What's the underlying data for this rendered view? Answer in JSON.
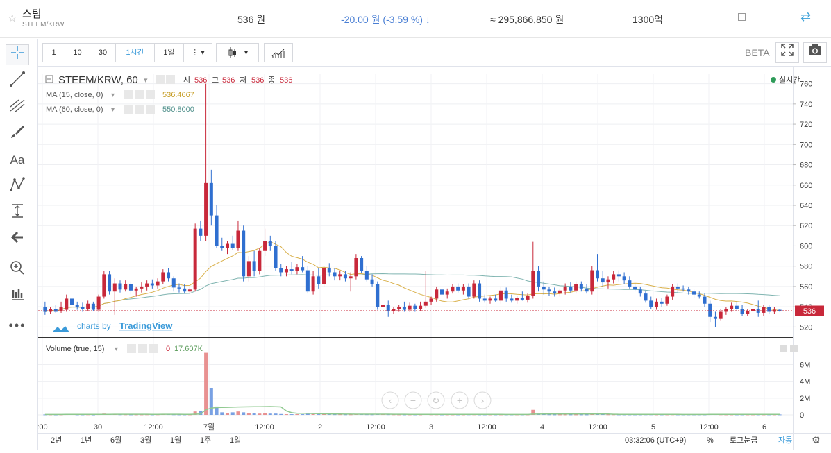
{
  "header": {
    "coin_name": "스팀",
    "pair": "STEEM/KRW",
    "price": "536 원",
    "change": "-20.00 원 (-3.59 %) ↓",
    "volume": "≈ 295,866,850 원",
    "market_cap": "1300억"
  },
  "toolbar": {
    "intervals": [
      "1",
      "10",
      "30",
      "1시간",
      "1일"
    ],
    "active_interval": "1시간",
    "beta_label": "BETA"
  },
  "legend": {
    "symbol": "STEEM/KRW, 60",
    "ohlc_labels": [
      "시",
      "고",
      "저",
      "종"
    ],
    "ohlc_values": [
      "536",
      "536",
      "536",
      "536"
    ],
    "ma15_label": "MA (15, close, 0)",
    "ma15_value": "536.4667",
    "ma60_label": "MA (60, close, 0)",
    "ma60_value": "550.8000",
    "realtime": "실시간",
    "volume_label": "Volume (true, 15)",
    "volume_values": [
      "0",
      "17.607K"
    ],
    "attribution_prefix": "charts by",
    "attribution_brand": "TradingView",
    "last_price_tag": "536"
  },
  "bottombar": {
    "ranges": [
      "2년",
      "1년",
      "6월",
      "3월",
      "1월",
      "1주",
      "1일"
    ],
    "clock": "03:32:06 (UTC+9)",
    "percent": "%",
    "log": "로그눈금",
    "auto": "자동"
  },
  "colors": {
    "up": "#c8283a",
    "down": "#2f6fd0",
    "ma15": "#d9b04a",
    "ma60": "#7fb4b0",
    "vol_ma": "#8fc98f",
    "accent": "#3a9ad9"
  },
  "chart_data": {
    "type": "candlestick",
    "price_axis_ticks": [
      520,
      540,
      560,
      580,
      600,
      620,
      640,
      660,
      680,
      700,
      720,
      740,
      760
    ],
    "price_range": [
      510,
      770
    ],
    "volume_axis_ticks": [
      "0",
      "2M",
      "4M",
      "6M"
    ],
    "volume_range": [
      0,
      7.2
    ],
    "time_ticks": [
      ":00",
      "30",
      "12:00",
      "7월",
      "12:00",
      "2",
      "12:00",
      "3",
      "12:00",
      "4",
      "12:00",
      "5",
      "12:00",
      "6"
    ],
    "candles": [
      {
        "o": 540,
        "h": 545,
        "l": 532,
        "c": 535
      },
      {
        "o": 535,
        "h": 540,
        "l": 533,
        "c": 538
      },
      {
        "o": 538,
        "h": 542,
        "l": 534,
        "c": 535
      },
      {
        "o": 536,
        "h": 545,
        "l": 534,
        "c": 540
      },
      {
        "o": 537,
        "h": 552,
        "l": 535,
        "c": 548
      },
      {
        "o": 548,
        "h": 558,
        "l": 540,
        "c": 542
      },
      {
        "o": 542,
        "h": 545,
        "l": 537,
        "c": 540
      },
      {
        "o": 540,
        "h": 544,
        "l": 535,
        "c": 538
      },
      {
        "o": 538,
        "h": 546,
        "l": 536,
        "c": 543
      },
      {
        "o": 543,
        "h": 545,
        "l": 536,
        "c": 537
      },
      {
        "o": 537,
        "h": 552,
        "l": 535,
        "c": 550
      },
      {
        "o": 550,
        "h": 575,
        "l": 548,
        "c": 572
      },
      {
        "o": 572,
        "h": 575,
        "l": 552,
        "c": 555
      },
      {
        "o": 555,
        "h": 568,
        "l": 532,
        "c": 563
      },
      {
        "o": 563,
        "h": 566,
        "l": 554,
        "c": 557
      },
      {
        "o": 557,
        "h": 566,
        "l": 555,
        "c": 562
      },
      {
        "o": 562,
        "h": 565,
        "l": 552,
        "c": 556
      },
      {
        "o": 556,
        "h": 560,
        "l": 550,
        "c": 558
      },
      {
        "o": 558,
        "h": 564,
        "l": 554,
        "c": 560
      },
      {
        "o": 560,
        "h": 566,
        "l": 556,
        "c": 563
      },
      {
        "o": 563,
        "h": 567,
        "l": 558,
        "c": 561
      },
      {
        "o": 561,
        "h": 568,
        "l": 558,
        "c": 565
      },
      {
        "o": 565,
        "h": 577,
        "l": 562,
        "c": 574
      },
      {
        "o": 574,
        "h": 578,
        "l": 565,
        "c": 568
      },
      {
        "o": 568,
        "h": 570,
        "l": 555,
        "c": 559
      },
      {
        "o": 559,
        "h": 563,
        "l": 554,
        "c": 558
      },
      {
        "o": 558,
        "h": 562,
        "l": 553,
        "c": 555
      },
      {
        "o": 555,
        "h": 560,
        "l": 553,
        "c": 557
      },
      {
        "o": 557,
        "h": 622,
        "l": 555,
        "c": 617
      },
      {
        "o": 617,
        "h": 625,
        "l": 605,
        "c": 610
      },
      {
        "o": 610,
        "h": 760,
        "l": 605,
        "c": 662
      },
      {
        "o": 662,
        "h": 675,
        "l": 620,
        "c": 630
      },
      {
        "o": 630,
        "h": 640,
        "l": 598,
        "c": 600
      },
      {
        "o": 600,
        "h": 608,
        "l": 595,
        "c": 598
      },
      {
        "o": 598,
        "h": 605,
        "l": 592,
        "c": 602
      },
      {
        "o": 602,
        "h": 610,
        "l": 596,
        "c": 598
      },
      {
        "o": 598,
        "h": 625,
        "l": 595,
        "c": 615
      },
      {
        "o": 615,
        "h": 620,
        "l": 565,
        "c": 570
      },
      {
        "o": 570,
        "h": 590,
        "l": 565,
        "c": 585
      },
      {
        "o": 585,
        "h": 595,
        "l": 570,
        "c": 575
      },
      {
        "o": 575,
        "h": 598,
        "l": 572,
        "c": 595
      },
      {
        "o": 595,
        "h": 617,
        "l": 590,
        "c": 605
      },
      {
        "o": 605,
        "h": 610,
        "l": 595,
        "c": 600
      },
      {
        "o": 600,
        "h": 605,
        "l": 575,
        "c": 578
      },
      {
        "o": 578,
        "h": 582,
        "l": 570,
        "c": 574
      },
      {
        "o": 574,
        "h": 580,
        "l": 570,
        "c": 577
      },
      {
        "o": 577,
        "h": 584,
        "l": 572,
        "c": 575
      },
      {
        "o": 575,
        "h": 582,
        "l": 572,
        "c": 579
      },
      {
        "o": 579,
        "h": 590,
        "l": 574,
        "c": 576
      },
      {
        "o": 576,
        "h": 580,
        "l": 553,
        "c": 555
      },
      {
        "o": 555,
        "h": 575,
        "l": 552,
        "c": 570
      },
      {
        "o": 570,
        "h": 578,
        "l": 558,
        "c": 562
      },
      {
        "o": 562,
        "h": 580,
        "l": 560,
        "c": 578
      },
      {
        "o": 578,
        "h": 583,
        "l": 570,
        "c": 574
      },
      {
        "o": 574,
        "h": 578,
        "l": 566,
        "c": 570
      },
      {
        "o": 570,
        "h": 575,
        "l": 566,
        "c": 572
      },
      {
        "o": 572,
        "h": 575,
        "l": 565,
        "c": 568
      },
      {
        "o": 568,
        "h": 574,
        "l": 555,
        "c": 570
      },
      {
        "o": 570,
        "h": 592,
        "l": 567,
        "c": 588
      },
      {
        "o": 588,
        "h": 590,
        "l": 573,
        "c": 575
      },
      {
        "o": 575,
        "h": 580,
        "l": 565,
        "c": 567
      },
      {
        "o": 567,
        "h": 572,
        "l": 560,
        "c": 562
      },
      {
        "o": 562,
        "h": 565,
        "l": 537,
        "c": 540
      },
      {
        "o": 540,
        "h": 545,
        "l": 533,
        "c": 542
      },
      {
        "o": 542,
        "h": 546,
        "l": 530,
        "c": 536
      },
      {
        "o": 536,
        "h": 540,
        "l": 533,
        "c": 538
      },
      {
        "o": 538,
        "h": 542,
        "l": 535,
        "c": 540
      },
      {
        "o": 540,
        "h": 545,
        "l": 535,
        "c": 537
      },
      {
        "o": 537,
        "h": 544,
        "l": 535,
        "c": 541
      },
      {
        "o": 541,
        "h": 543,
        "l": 535,
        "c": 538
      },
      {
        "o": 538,
        "h": 545,
        "l": 536,
        "c": 541
      },
      {
        "o": 541,
        "h": 575,
        "l": 539,
        "c": 545
      },
      {
        "o": 545,
        "h": 550,
        "l": 542,
        "c": 548
      },
      {
        "o": 548,
        "h": 560,
        "l": 545,
        "c": 557
      },
      {
        "o": 557,
        "h": 565,
        "l": 550,
        "c": 552
      },
      {
        "o": 552,
        "h": 558,
        "l": 548,
        "c": 555
      },
      {
        "o": 555,
        "h": 562,
        "l": 553,
        "c": 560
      },
      {
        "o": 560,
        "h": 563,
        "l": 554,
        "c": 556
      },
      {
        "o": 556,
        "h": 562,
        "l": 552,
        "c": 560
      },
      {
        "o": 560,
        "h": 563,
        "l": 548,
        "c": 550
      },
      {
        "o": 550,
        "h": 566,
        "l": 548,
        "c": 563
      },
      {
        "o": 563,
        "h": 566,
        "l": 545,
        "c": 548
      },
      {
        "o": 548,
        "h": 552,
        "l": 544,
        "c": 546
      },
      {
        "o": 546,
        "h": 550,
        "l": 543,
        "c": 548
      },
      {
        "o": 548,
        "h": 552,
        "l": 545,
        "c": 546
      },
      {
        "o": 546,
        "h": 560,
        "l": 543,
        "c": 556
      },
      {
        "o": 556,
        "h": 559,
        "l": 545,
        "c": 548
      },
      {
        "o": 548,
        "h": 552,
        "l": 544,
        "c": 546
      },
      {
        "o": 546,
        "h": 551,
        "l": 543,
        "c": 549
      },
      {
        "o": 549,
        "h": 555,
        "l": 546,
        "c": 547
      },
      {
        "o": 547,
        "h": 553,
        "l": 544,
        "c": 551
      },
      {
        "o": 551,
        "h": 604,
        "l": 548,
        "c": 575
      },
      {
        "o": 575,
        "h": 580,
        "l": 555,
        "c": 560
      },
      {
        "o": 560,
        "h": 565,
        "l": 552,
        "c": 557
      },
      {
        "o": 557,
        "h": 560,
        "l": 551,
        "c": 555
      },
      {
        "o": 555,
        "h": 559,
        "l": 550,
        "c": 553
      },
      {
        "o": 553,
        "h": 558,
        "l": 550,
        "c": 556
      },
      {
        "o": 556,
        "h": 563,
        "l": 552,
        "c": 560
      },
      {
        "o": 560,
        "h": 564,
        "l": 554,
        "c": 556
      },
      {
        "o": 556,
        "h": 565,
        "l": 553,
        "c": 562
      },
      {
        "o": 562,
        "h": 565,
        "l": 555,
        "c": 558
      },
      {
        "o": 558,
        "h": 562,
        "l": 553,
        "c": 555
      },
      {
        "o": 555,
        "h": 580,
        "l": 552,
        "c": 576
      },
      {
        "o": 576,
        "h": 592,
        "l": 565,
        "c": 568
      },
      {
        "o": 568,
        "h": 575,
        "l": 560,
        "c": 564
      },
      {
        "o": 564,
        "h": 570,
        "l": 558,
        "c": 567
      },
      {
        "o": 567,
        "h": 575,
        "l": 563,
        "c": 572
      },
      {
        "o": 572,
        "h": 576,
        "l": 565,
        "c": 570
      },
      {
        "o": 570,
        "h": 574,
        "l": 562,
        "c": 566
      },
      {
        "o": 566,
        "h": 570,
        "l": 558,
        "c": 560
      },
      {
        "o": 560,
        "h": 563,
        "l": 555,
        "c": 557
      },
      {
        "o": 557,
        "h": 560,
        "l": 550,
        "c": 553
      },
      {
        "o": 553,
        "h": 556,
        "l": 544,
        "c": 546
      },
      {
        "o": 546,
        "h": 550,
        "l": 538,
        "c": 540
      },
      {
        "o": 540,
        "h": 548,
        "l": 537,
        "c": 545
      },
      {
        "o": 545,
        "h": 549,
        "l": 540,
        "c": 543
      },
      {
        "o": 543,
        "h": 552,
        "l": 541,
        "c": 550
      },
      {
        "o": 550,
        "h": 562,
        "l": 547,
        "c": 560
      },
      {
        "o": 560,
        "h": 563,
        "l": 554,
        "c": 558
      },
      {
        "o": 558,
        "h": 561,
        "l": 555,
        "c": 557
      },
      {
        "o": 557,
        "h": 560,
        "l": 552,
        "c": 555
      },
      {
        "o": 555,
        "h": 557,
        "l": 549,
        "c": 552
      },
      {
        "o": 552,
        "h": 555,
        "l": 548,
        "c": 550
      },
      {
        "o": 550,
        "h": 553,
        "l": 540,
        "c": 543
      },
      {
        "o": 543,
        "h": 546,
        "l": 525,
        "c": 530
      },
      {
        "o": 530,
        "h": 535,
        "l": 520,
        "c": 528
      },
      {
        "o": 528,
        "h": 538,
        "l": 526,
        "c": 535
      },
      {
        "o": 535,
        "h": 540,
        "l": 532,
        "c": 538
      },
      {
        "o": 538,
        "h": 544,
        "l": 535,
        "c": 541
      },
      {
        "o": 541,
        "h": 545,
        "l": 536,
        "c": 538
      },
      {
        "o": 538,
        "h": 542,
        "l": 531,
        "c": 533
      },
      {
        "o": 533,
        "h": 538,
        "l": 531,
        "c": 536
      },
      {
        "o": 536,
        "h": 540,
        "l": 533,
        "c": 538
      },
      {
        "o": 538,
        "h": 546,
        "l": 530,
        "c": 534
      },
      {
        "o": 534,
        "h": 542,
        "l": 531,
        "c": 540
      },
      {
        "o": 540,
        "h": 542,
        "l": 533,
        "c": 535
      },
      {
        "o": 535,
        "h": 540,
        "l": 533,
        "c": 537
      },
      {
        "o": 537,
        "h": 538,
        "l": 535,
        "c": 536
      }
    ],
    "volumes": [
      0.05,
      0.05,
      0.04,
      0.05,
      0.08,
      0.1,
      0.05,
      0.05,
      0.06,
      0.04,
      0.08,
      0.15,
      0.1,
      0.1,
      0.06,
      0.06,
      0.05,
      0.05,
      0.05,
      0.06,
      0.05,
      0.06,
      0.1,
      0.08,
      0.06,
      0.05,
      0.05,
      0.05,
      0.4,
      0.5,
      7.4,
      3.2,
      1.0,
      0.3,
      0.2,
      0.3,
      0.4,
      0.3,
      0.2,
      0.2,
      0.15,
      0.2,
      0.15,
      0.15,
      0.1,
      0.08,
      0.08,
      0.08,
      0.08,
      0.12,
      0.1,
      0.08,
      0.1,
      0.08,
      0.07,
      0.07,
      0.06,
      0.06,
      0.1,
      0.08,
      0.07,
      0.06,
      0.1,
      0.08,
      0.07,
      0.06,
      0.05,
      0.05,
      0.05,
      0.05,
      0.05,
      0.1,
      0.06,
      0.06,
      0.05,
      0.05,
      0.05,
      0.05,
      0.05,
      0.06,
      0.06,
      0.05,
      0.05,
      0.05,
      0.05,
      0.05,
      0.05,
      0.05,
      0.05,
      0.05,
      0.05,
      0.6,
      0.15,
      0.08,
      0.06,
      0.05,
      0.05,
      0.05,
      0.05,
      0.05,
      0.05,
      0.05,
      0.1,
      0.15,
      0.08,
      0.06,
      0.06,
      0.05,
      0.05,
      0.05,
      0.05,
      0.05,
      0.06,
      0.06,
      0.05,
      0.05,
      0.05,
      0.06,
      0.05,
      0.05,
      0.05,
      0.05,
      0.05,
      0.05,
      0.08,
      0.08,
      0.06,
      0.05,
      0.05,
      0.05,
      0.05,
      0.05,
      0.05,
      0.05,
      0.05,
      0.05,
      0.05,
      0.05
    ]
  }
}
